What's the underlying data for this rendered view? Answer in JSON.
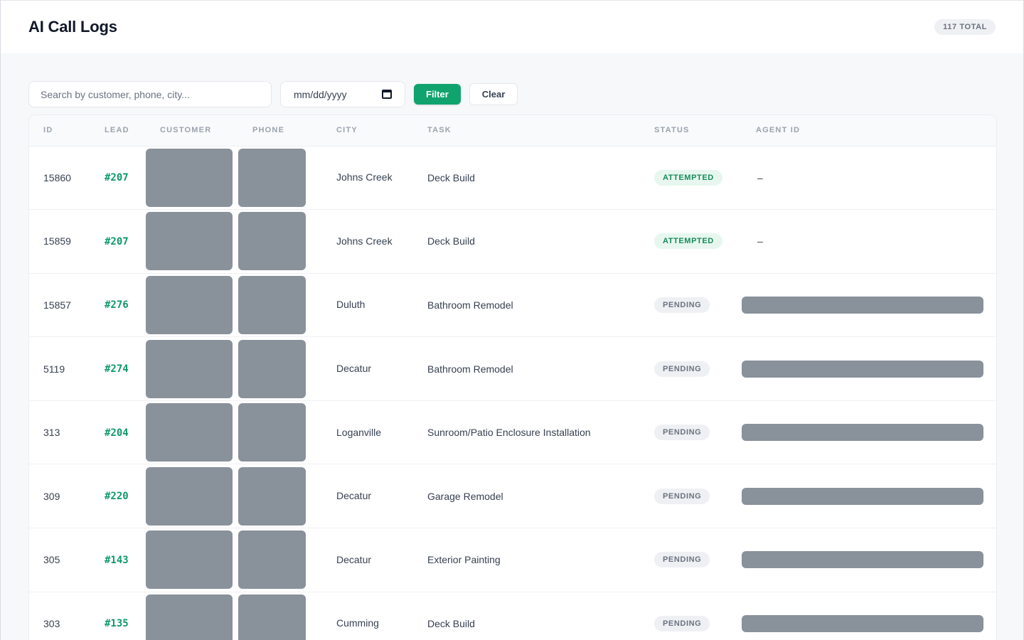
{
  "header": {
    "title": "AI Call Logs",
    "total": "117 TOTAL"
  },
  "filters": {
    "search_placeholder": "Search by customer, phone, city...",
    "date_placeholder": "mm/dd/yyyy",
    "filter_label": "Filter",
    "clear_label": "Clear"
  },
  "table": {
    "columns": [
      "ID",
      "LEAD",
      "CUSTOMER",
      "PHONE",
      "CITY",
      "TASK",
      "STATUS",
      "AGENT ID"
    ],
    "rows": [
      {
        "id": "15860",
        "lead": "#207",
        "city": "Johns Creek",
        "task": "Deck Build",
        "status": "ATTEMPTED",
        "agent": "–"
      },
      {
        "id": "15859",
        "lead": "#207",
        "city": "Johns Creek",
        "task": "Deck Build",
        "status": "ATTEMPTED",
        "agent": "–"
      },
      {
        "id": "15857",
        "lead": "#276",
        "city": "Duluth",
        "task": "Bathroom Remodel",
        "status": "PENDING",
        "agent": ""
      },
      {
        "id": "5119",
        "lead": "#274",
        "city": "Decatur",
        "task": "Bathroom Remodel",
        "status": "PENDING",
        "agent": ""
      },
      {
        "id": "313",
        "lead": "#204",
        "city": "Loganville",
        "task": "Sunroom/Patio Enclosure Installation",
        "status": "PENDING",
        "agent": ""
      },
      {
        "id": "309",
        "lead": "#220",
        "city": "Decatur",
        "task": "Garage Remodel",
        "status": "PENDING",
        "agent": ""
      },
      {
        "id": "305",
        "lead": "#143",
        "city": "Decatur",
        "task": "Exterior Painting",
        "status": "PENDING",
        "agent": ""
      },
      {
        "id": "303",
        "lead": "#135",
        "city": "Cumming",
        "task": "Deck Build",
        "status": "PENDING",
        "agent": ""
      }
    ]
  },
  "colors": {
    "accent": "#10a36e",
    "redacted": "#89919b"
  }
}
